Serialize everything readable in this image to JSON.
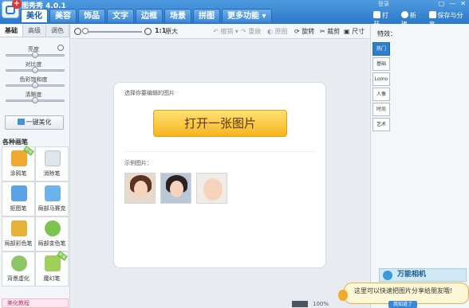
{
  "app": {
    "title": "图秀秀 4.0.1",
    "login": "登录"
  },
  "tabs": [
    "美化",
    "美容",
    "饰品",
    "文字",
    "边框",
    "场景",
    "拼图",
    "更多功能 ▾"
  ],
  "window_controls": [
    "▢",
    "—",
    "✕"
  ],
  "top_actions": {
    "open": "打开",
    "new": "新建",
    "save": "保存与分享"
  },
  "left": {
    "subtabs": [
      "基础",
      "高级",
      "调色"
    ],
    "sliders": [
      {
        "label": "亮度",
        "value": 0.5
      },
      {
        "label": "对比度",
        "value": 0.5
      },
      {
        "label": "色彩饱和度",
        "value": 0.5
      },
      {
        "label": "清晰度",
        "value": 0.5
      }
    ],
    "onekey": "一键美化",
    "section": "各种画笔",
    "tools": [
      {
        "label": "涂鸦笔",
        "badge": "新版",
        "color": "#f0a830"
      },
      {
        "label": "消除笔",
        "badge": "",
        "color": "#e9eef3"
      },
      {
        "label": "抠图笔",
        "badge": "",
        "color": "#5aa3e6"
      },
      {
        "label": "局部马赛克",
        "badge": "",
        "color": "#6bb3ea"
      },
      {
        "label": "局部彩色笔",
        "badge": "",
        "color": "#e8b23a"
      },
      {
        "label": "局部变色笔",
        "badge": "",
        "color": "#7cc44f"
      },
      {
        "label": "背景虚化",
        "badge": "",
        "color": "#8fc468"
      },
      {
        "label": "魔幻笔",
        "badge": "新版",
        "color": "#9fd05a"
      }
    ],
    "bottom": "美化教程"
  },
  "toolbar": {
    "zoom": "1:1",
    "fit": "原大",
    "undo": "撤销",
    "redo": "重做",
    "original": "原图",
    "rotate": "旋转",
    "crop": "裁剪",
    "size": "尺寸"
  },
  "canvas": {
    "hint": "选择你要编辑的图片",
    "open_button": "打开一张图片",
    "sample_label": "示例图片："
  },
  "right": {
    "title": "特效：",
    "tabs": [
      "热门",
      "基础",
      "Lomo",
      "人像",
      "时尚",
      "艺术"
    ],
    "ad": "万能相机"
  },
  "bubble": {
    "text": "这里可以快速把图片分享给朋友哦!",
    "button": "我知道了"
  },
  "status": {
    "zoom": "100%"
  },
  "colors": {
    "accent": "#2b78c8",
    "button": "#f7b51f",
    "active_tab": "#2f7fcf"
  }
}
